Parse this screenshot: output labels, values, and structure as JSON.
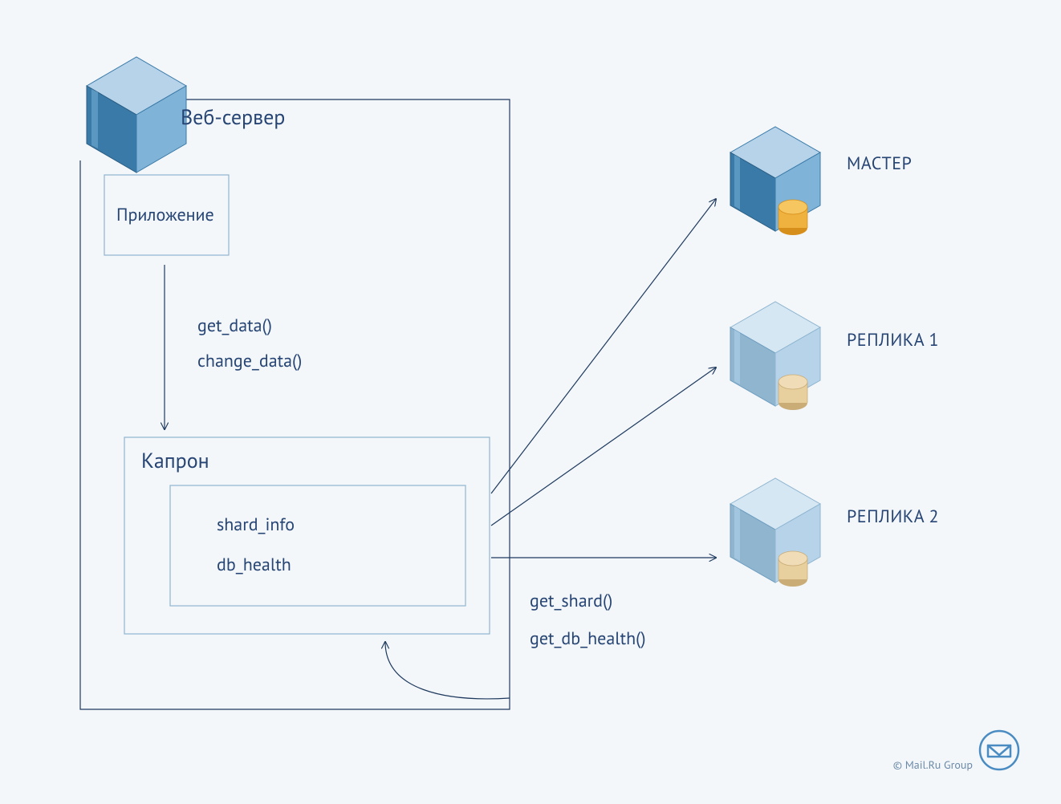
{
  "title": "Веб-сервер",
  "boxes": {
    "web_server": "Веб-сервер",
    "application": "Приложение",
    "kapron": "Капрон",
    "kapron_items": [
      "shard_info",
      "db_health"
    ]
  },
  "calls": {
    "app_to_kapron": [
      "get_data()",
      "change_data()"
    ],
    "kapron_loop": [
      "get_shard()",
      "get_db_health()"
    ]
  },
  "nodes": {
    "master": "МАСТЕР",
    "replica1": "РЕПЛИКА 1",
    "replica2": "РЕПЛИКА 2"
  },
  "footer": "© Mail.Ru Group",
  "colors": {
    "stroke": "#1f3a5f",
    "box_stroke": "#8fb5cf",
    "server_light": "#b6d3ea",
    "server_mid": "#7fb3d7",
    "server_dark": "#3a7aa8",
    "cyl_orange": "#f0b23e",
    "cyl_orange_dark": "#d68f1a",
    "cyl_tan": "#e8cf9e",
    "cyl_tan_dark": "#c9ac76",
    "bg": "#f3f7fa"
  }
}
